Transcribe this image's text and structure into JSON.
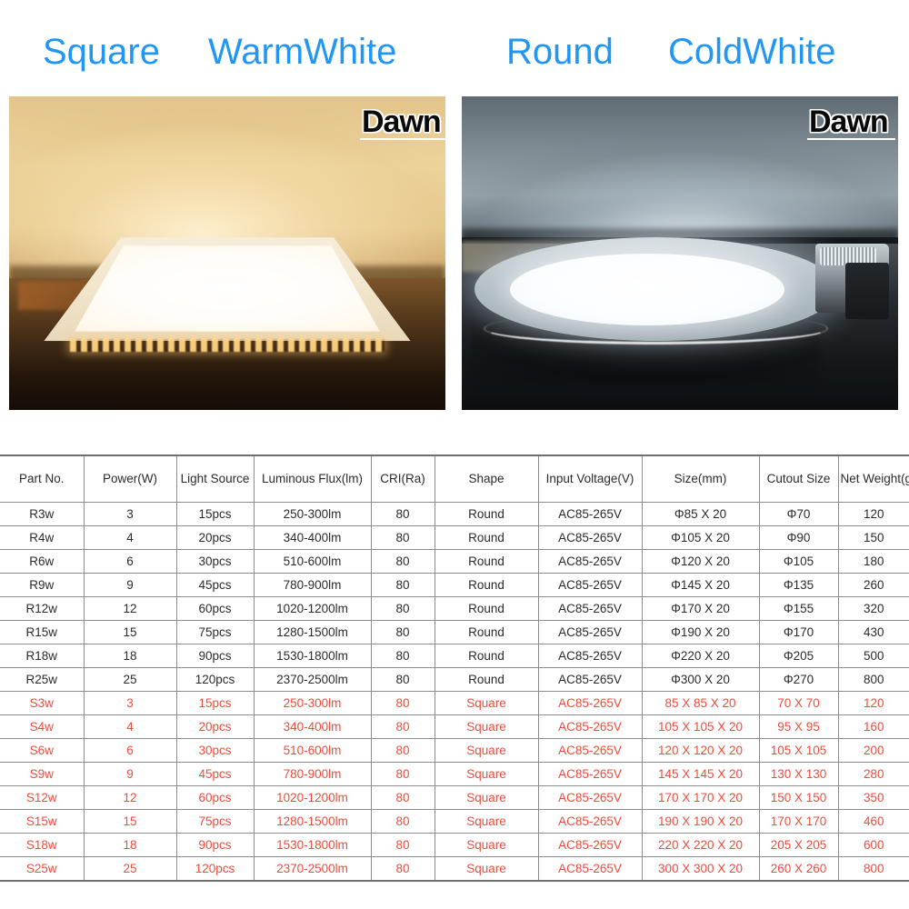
{
  "headline": {
    "color": "#2196f3",
    "items": [
      {
        "label": "Square"
      },
      {
        "label": "WarmWhite"
      },
      {
        "label": "Round"
      },
      {
        "label": "ColdWhite"
      }
    ]
  },
  "photos": {
    "left": {
      "caption_pair": "Square WarmWhite",
      "watermark": "Dawn",
      "description": "Warm white square LED panel light lit on a table against a wall"
    },
    "right": {
      "caption_pair": "Round ColdWhite",
      "watermark": "Dawn",
      "description": "Cold white round LED panel light lit on a table with driver box"
    }
  },
  "spec_table": {
    "columns": [
      "Part No.",
      "Power(W)",
      "Light Source",
      "Luminous Flux(lm)",
      "CRI(Ra)",
      "Shape",
      "Input Voltage(V)",
      "Size(mm)",
      "Cutout Size",
      "Net Weight(g)"
    ],
    "round_text_color": "#2b2b2b",
    "square_text_color": "#ef4b3c",
    "rows": [
      {
        "group": "round",
        "cells": [
          "R3w",
          "3",
          "15pcs",
          "250-300lm",
          "80",
          "Round",
          "AC85-265V",
          "Φ85 X 20",
          "Φ70",
          "120"
        ]
      },
      {
        "group": "round",
        "cells": [
          "R4w",
          "4",
          "20pcs",
          "340-400lm",
          "80",
          "Round",
          "AC85-265V",
          "Φ105 X 20",
          "Φ90",
          "150"
        ]
      },
      {
        "group": "round",
        "cells": [
          "R6w",
          "6",
          "30pcs",
          "510-600lm",
          "80",
          "Round",
          "AC85-265V",
          "Φ120 X 20",
          "Φ105",
          "180"
        ]
      },
      {
        "group": "round",
        "cells": [
          "R9w",
          "9",
          "45pcs",
          "780-900lm",
          "80",
          "Round",
          "AC85-265V",
          "Φ145 X 20",
          "Φ135",
          "260"
        ]
      },
      {
        "group": "round",
        "cells": [
          "R12w",
          "12",
          "60pcs",
          "1020-1200lm",
          "80",
          "Round",
          "AC85-265V",
          "Φ170 X 20",
          "Φ155",
          "320"
        ]
      },
      {
        "group": "round",
        "cells": [
          "R15w",
          "15",
          "75pcs",
          "1280-1500lm",
          "80",
          "Round",
          "AC85-265V",
          "Φ190 X 20",
          "Φ170",
          "430"
        ]
      },
      {
        "group": "round",
        "cells": [
          "R18w",
          "18",
          "90pcs",
          "1530-1800lm",
          "80",
          "Round",
          "AC85-265V",
          "Φ220 X 20",
          "Φ205",
          "500"
        ]
      },
      {
        "group": "round",
        "cells": [
          "R25w",
          "25",
          "120pcs",
          "2370-2500lm",
          "80",
          "Round",
          "AC85-265V",
          "Φ300 X 20",
          "Φ270",
          "800"
        ]
      },
      {
        "group": "square",
        "cells": [
          "S3w",
          "3",
          "15pcs",
          "250-300lm",
          "80",
          "Square",
          "AC85-265V",
          "85 X 85 X 20",
          "70 X 70",
          "120"
        ]
      },
      {
        "group": "square",
        "cells": [
          "S4w",
          "4",
          "20pcs",
          "340-400lm",
          "80",
          "Square",
          "AC85-265V",
          "105 X 105 X 20",
          "95 X 95",
          "160"
        ]
      },
      {
        "group": "square",
        "cells": [
          "S6w",
          "6",
          "30pcs",
          "510-600lm",
          "80",
          "Square",
          "AC85-265V",
          "120 X 120 X 20",
          "105 X 105",
          "200"
        ]
      },
      {
        "group": "square",
        "cells": [
          "S9w",
          "9",
          "45pcs",
          "780-900lm",
          "80",
          "Square",
          "AC85-265V",
          "145 X 145 X 20",
          "130 X 130",
          "280"
        ]
      },
      {
        "group": "square",
        "cells": [
          "S12w",
          "12",
          "60pcs",
          "1020-1200lm",
          "80",
          "Square",
          "AC85-265V",
          "170 X 170 X 20",
          "150 X 150",
          "350"
        ]
      },
      {
        "group": "square",
        "cells": [
          "S15w",
          "15",
          "75pcs",
          "1280-1500lm",
          "80",
          "Square",
          "AC85-265V",
          "190 X 190 X 20",
          "170 X 170",
          "460"
        ]
      },
      {
        "group": "square",
        "cells": [
          "S18w",
          "18",
          "90pcs",
          "1530-1800lm",
          "80",
          "Square",
          "AC85-265V",
          "220 X 220 X 20",
          "205 X 205",
          "600"
        ]
      },
      {
        "group": "square",
        "cells": [
          "S25w",
          "25",
          "120pcs",
          "2370-2500lm",
          "80",
          "Square",
          "AC85-265V",
          "300 X 300 X 20",
          "260 X 260",
          "800"
        ]
      }
    ]
  }
}
